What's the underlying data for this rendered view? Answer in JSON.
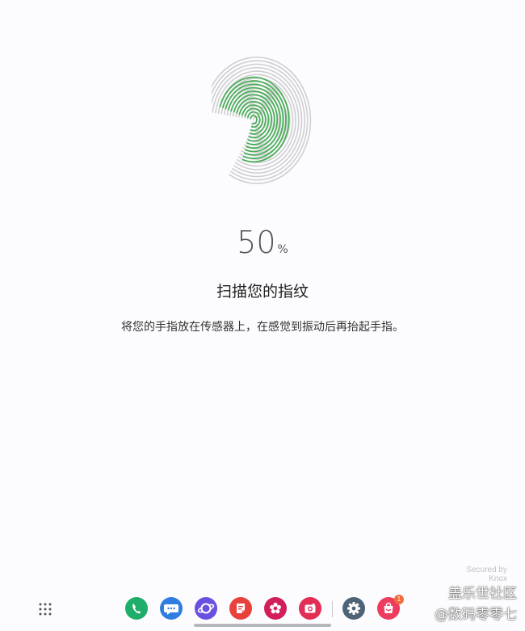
{
  "scan": {
    "progress_value": "50",
    "progress_unit": "%",
    "progress_fraction": 0.5,
    "title": "扫描您的指纹",
    "instruction": "将您的手指放在传感器上，在感觉到振动后再抬起手指。"
  },
  "branding": {
    "secured_line1": "Secured by",
    "secured_line2": "Knox"
  },
  "watermark": {
    "line1": "盖乐世社区",
    "line2": "@数码零零七"
  },
  "dock": {
    "notification_count": "1",
    "apps": [
      {
        "name": "phone",
        "icon": "phone-icon",
        "color": "#1fae6a"
      },
      {
        "name": "messages",
        "icon": "message-icon",
        "color": "#2f7de1"
      },
      {
        "name": "internet",
        "icon": "internet-icon",
        "color": "#6a4fe0"
      },
      {
        "name": "notes",
        "icon": "notes-icon",
        "color": "#e8413c"
      },
      {
        "name": "gallery",
        "icon": "gallery-icon",
        "color": "#d21f5a"
      },
      {
        "name": "camera",
        "icon": "camera-icon",
        "color": "#e22d55"
      },
      {
        "name": "settings",
        "icon": "gear-icon",
        "color": "#4f6376"
      },
      {
        "name": "store",
        "icon": "store-icon",
        "color": "#ee3c5f"
      }
    ]
  },
  "colors": {
    "fingerprint_scanned": "#4cae5a",
    "fingerprint_unscanned": "#cfcfd2",
    "text_primary": "#1e1e1e",
    "text_secondary": "#555555"
  }
}
